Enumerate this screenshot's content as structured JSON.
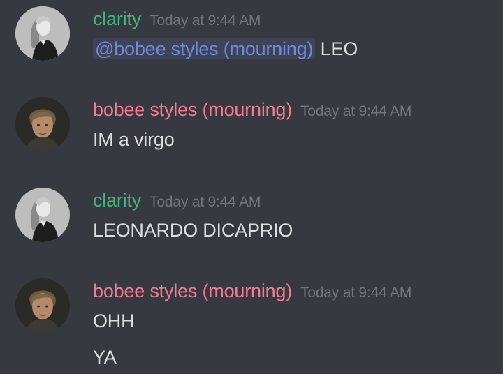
{
  "colors": {
    "background": "#36393f",
    "clarity_name": "#43b581",
    "bobee_name": "#f47b96",
    "timestamp": "#72767d",
    "text": "#dcddde",
    "mention": "#7289da"
  },
  "messages": [
    {
      "author": "clarity",
      "timestamp": "Today at 9:44 AM",
      "avatar_icon": "woman-portrait-avatar",
      "lines": [
        {
          "mention": "@bobee styles (mourning)",
          "text": "LEO"
        }
      ]
    },
    {
      "author": "bobee styles (mourning)",
      "timestamp": "Today at 9:44 AM",
      "avatar_icon": "man-portrait-avatar",
      "lines": [
        {
          "text": "IM a virgo"
        }
      ]
    },
    {
      "author": "clarity",
      "timestamp": "Today at 9:44 AM",
      "avatar_icon": "woman-portrait-avatar",
      "lines": [
        {
          "text": "LEONARDO DICAPRIO"
        }
      ]
    },
    {
      "author": "bobee styles (mourning)",
      "timestamp": "Today at 9:44 AM",
      "avatar_icon": "man-portrait-avatar",
      "lines": [
        {
          "text": "OHH"
        },
        {
          "text": "YA"
        }
      ]
    }
  ]
}
